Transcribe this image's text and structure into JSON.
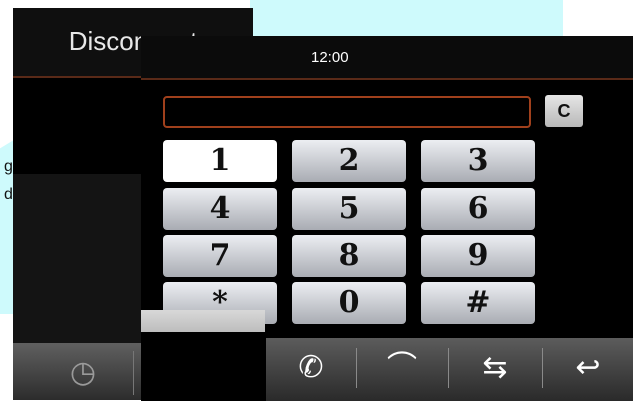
{
  "background": {
    "side_text": [
      "gen",
      "dy"
    ]
  },
  "back_screen": {
    "title": "Disconnect",
    "bottom_icons": [
      "history-icon",
      "contacts-icon"
    ]
  },
  "front_screen": {
    "status_bar": {
      "time": "12:00"
    },
    "number_field": {
      "value": ""
    },
    "clear_button": {
      "label": "C"
    },
    "keypad": {
      "keys": [
        "1",
        "2",
        "3",
        "4",
        "5",
        "6",
        "7",
        "8",
        "9",
        "*",
        "0",
        "#"
      ],
      "active_key": "1"
    },
    "bottom_bar": {
      "buttons": [
        {
          "icon": "call-icon",
          "glyph": "✆"
        },
        {
          "icon": "hang-up-icon",
          "glyph": "⌒"
        },
        {
          "icon": "swap-icon",
          "glyph": "⇆"
        },
        {
          "icon": "back-icon",
          "glyph": "↩"
        }
      ]
    },
    "colors": {
      "accent_border": "#a0401c",
      "key_active": "#ffffff"
    }
  }
}
